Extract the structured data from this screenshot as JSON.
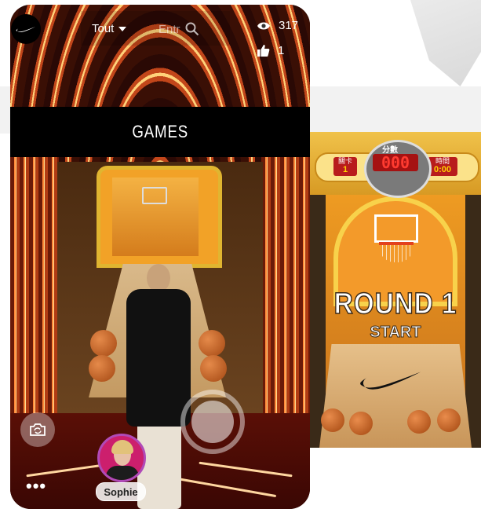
{
  "header": {
    "filter_label": "Tout",
    "search_placeholder": "Entr",
    "views": "317",
    "likes": "1"
  },
  "banner": {
    "label": "GAMES"
  },
  "creator": {
    "name": "Sophie"
  },
  "controls": {
    "more_label": "•••"
  },
  "game_preview": {
    "score_title": "分數",
    "score_value": "000",
    "level_label": "關卡",
    "level_value": "1",
    "time_label": "時間",
    "time_value": "0:00",
    "round_text": "ROUND 1",
    "start_text": "START"
  },
  "icons": [
    "nike-logo-icon",
    "chevron-down-icon",
    "search-icon",
    "eye-icon",
    "thumbs-up-icon",
    "camera-flip-icon",
    "more-icon",
    "nike-swoosh-icon"
  ]
}
